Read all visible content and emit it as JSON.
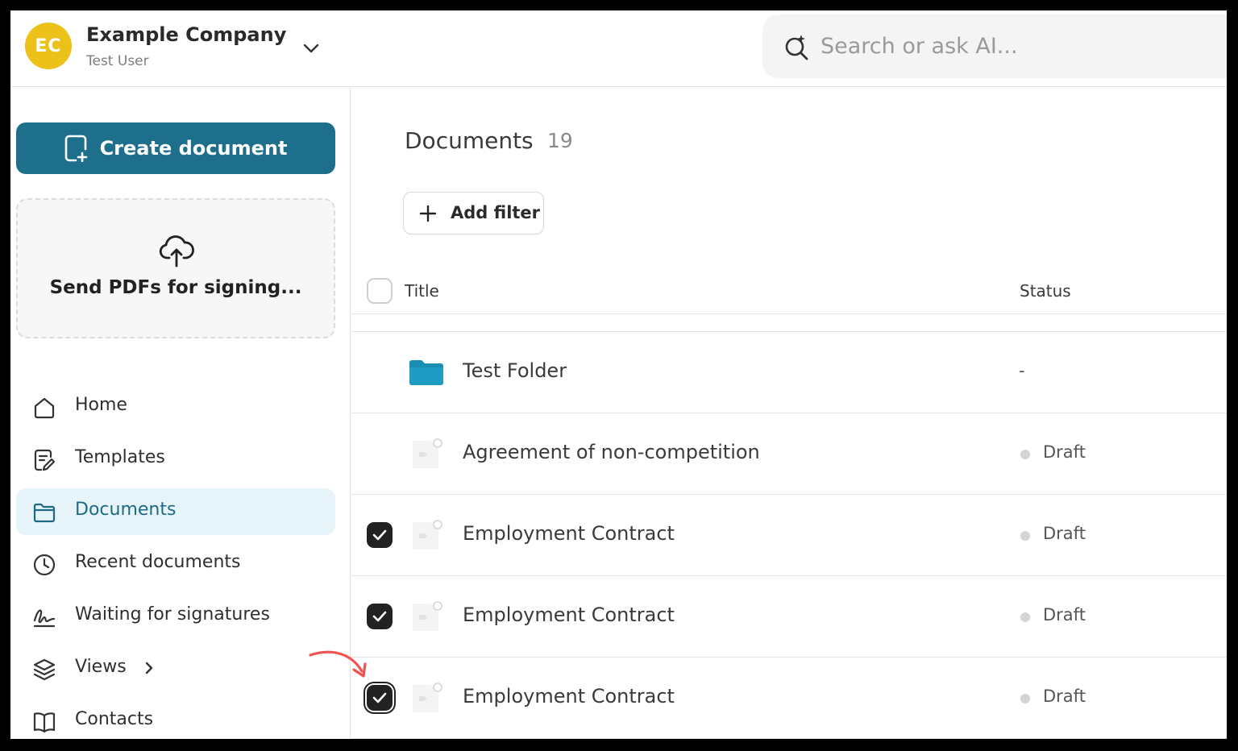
{
  "account": {
    "initials": "EC",
    "company": "Example Company",
    "user": "Test User",
    "avatar_color": "#ecc21a"
  },
  "search": {
    "placeholder": "Search or ask AI..."
  },
  "sidebar": {
    "create_label": "Create document",
    "upload_label": "Send PDFs for signing...",
    "items": [
      {
        "label": "Home",
        "icon": "home-icon"
      },
      {
        "label": "Templates",
        "icon": "template-icon"
      },
      {
        "label": "Documents",
        "icon": "folder-icon",
        "active": true
      },
      {
        "label": "Recent documents",
        "icon": "clock-icon"
      },
      {
        "label": "Waiting for signatures",
        "icon": "signature-icon"
      },
      {
        "label": "Views",
        "icon": "layers-icon"
      },
      {
        "label": "Contacts",
        "icon": "book-icon"
      }
    ]
  },
  "main": {
    "title": "Documents",
    "count": "19",
    "add_filter_label": "Add filter",
    "columns": {
      "title": "Title",
      "status": "Status"
    },
    "rows": [
      {
        "title": "Test Folder",
        "status": "-",
        "type": "folder",
        "checked": false
      },
      {
        "title": "Agreement of non-competition",
        "status": "Draft",
        "type": "document",
        "checked": false
      },
      {
        "title": "Employment Contract",
        "status": "Draft",
        "type": "document",
        "checked": true
      },
      {
        "title": "Employment Contract",
        "status": "Draft",
        "type": "document",
        "checked": true
      },
      {
        "title": "Employment Contract",
        "status": "Draft",
        "type": "document",
        "checked": true
      }
    ]
  },
  "colors": {
    "primary": "#1e6f8b",
    "active_nav_bg": "#e7f4f9",
    "folder": "#1a8fb3",
    "annotation_arrow": "#ef5350"
  }
}
